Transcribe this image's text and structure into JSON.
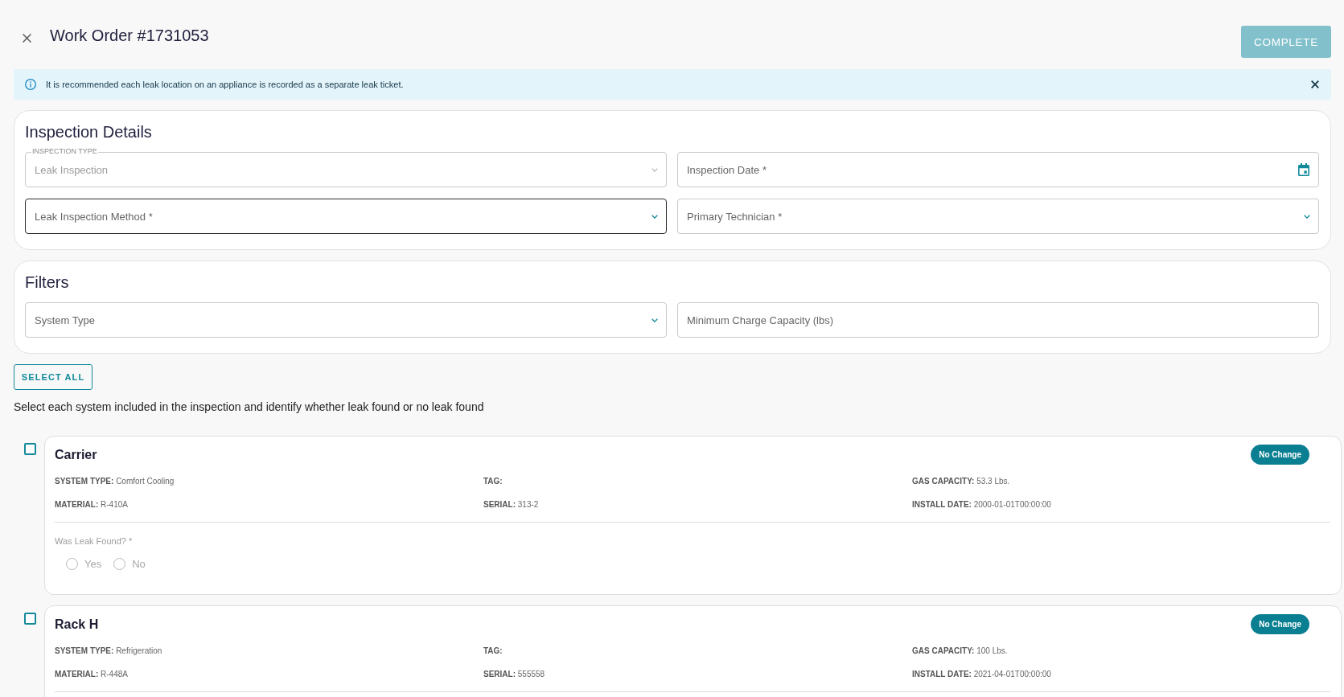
{
  "header": {
    "title": "Work Order #1731053",
    "complete_button": {
      "label": "COMPLETE",
      "disabled": true
    }
  },
  "alert": {
    "message": "It is recommended each leak location on an appliance is recorded as a separate leak ticket."
  },
  "inspection_details": {
    "title": "Inspection Details",
    "fields": [
      {
        "kind": "select",
        "label": "INSPECTION TYPE",
        "value": "Leak Inspection",
        "disabled": true,
        "focused": false
      },
      {
        "kind": "date",
        "placeholder": "Inspection Date *",
        "disabled": false,
        "focused": false
      },
      {
        "kind": "select",
        "placeholder": "Leak Inspection Method *",
        "disabled": false,
        "focused": true
      },
      {
        "kind": "select",
        "placeholder": "Primary Technician *",
        "disabled": false,
        "focused": false
      }
    ]
  },
  "filters": {
    "title": "Filters",
    "fields": [
      {
        "kind": "select",
        "placeholder": "System Type",
        "disabled": false,
        "focused": false
      },
      {
        "kind": "text",
        "placeholder": "Minimum Charge Capacity (lbs)",
        "disabled": false,
        "focused": false
      }
    ]
  },
  "select_all_button": {
    "label": "SELECT ALL"
  },
  "instructions": "Select each system included in the inspection and identify whether leak found or no leak found",
  "systems": [
    {
      "name": "Carrier",
      "checked": false,
      "status": "No Change",
      "details": [
        {
          "label": "SYSTEM TYPE:",
          "value": "Comfort Cooling"
        },
        {
          "label": "TAG:"
        },
        {
          "label": "GAS CAPACITY:",
          "value": "53.3 Lbs."
        },
        {
          "label": "MATERIAL:",
          "value": "R-410A"
        },
        {
          "label": "SERIAL:",
          "value": "313-2"
        },
        {
          "label": "INSTALL DATE:",
          "value": "2000-01-01T00:00:00"
        }
      ],
      "leak_question": {
        "label": "Was Leak Found? *",
        "disabled": true,
        "options": [
          {
            "label": "Yes",
            "selected": false
          },
          {
            "label": "No",
            "selected": false
          }
        ]
      }
    },
    {
      "name": "Rack H",
      "checked": false,
      "status": "No Change",
      "details": [
        {
          "label": "SYSTEM TYPE:",
          "value": "Refrigeration"
        },
        {
          "label": "TAG:"
        },
        {
          "label": "GAS CAPACITY:",
          "value": "100 Lbs."
        },
        {
          "label": "MATERIAL:",
          "value": "R-448A"
        },
        {
          "label": "SERIAL:",
          "value": "555558"
        },
        {
          "label": "INSTALL DATE:",
          "value": "2021-04-01T00:00:00"
        }
      ]
    }
  ]
}
